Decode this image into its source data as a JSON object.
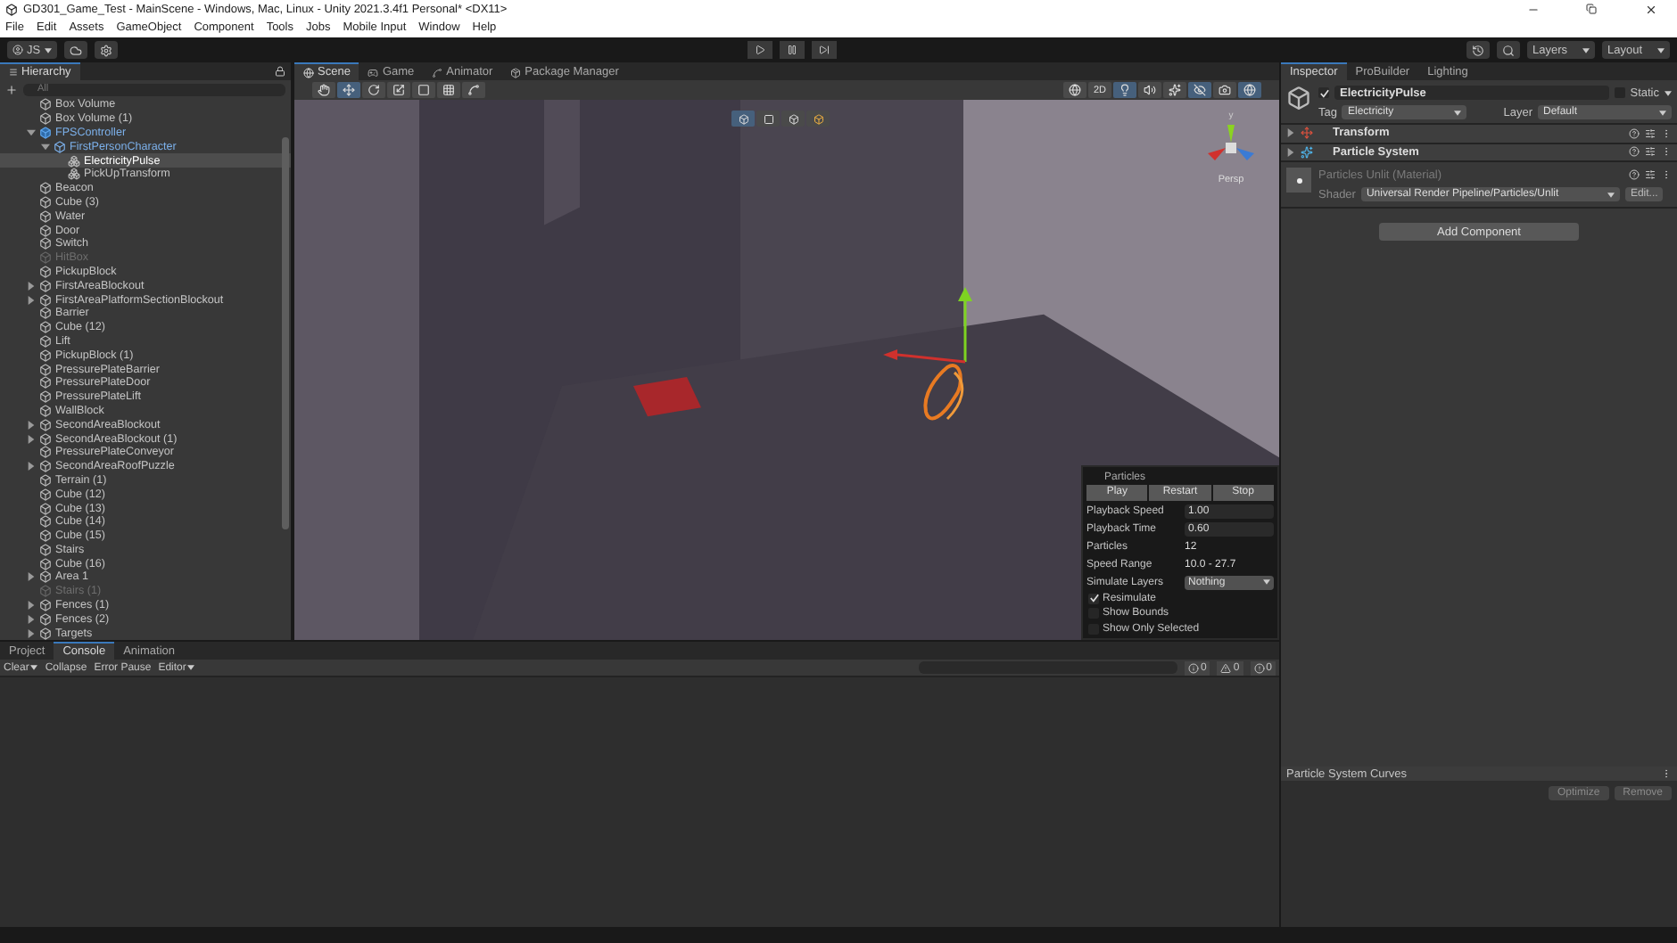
{
  "window": {
    "title": "GD301_Game_Test - MainScene - Windows, Mac, Linux - Unity 2021.3.4f1 Personal* <DX11>"
  },
  "menu": [
    "File",
    "Edit",
    "Assets",
    "GameObject",
    "Component",
    "Tools",
    "Jobs",
    "Mobile Input",
    "Window",
    "Help"
  ],
  "toolbar": {
    "account": "JS",
    "layers": "Layers",
    "layout": "Layout"
  },
  "hierarchy": {
    "title": "Hierarchy",
    "search_placeholder": "All",
    "items": [
      {
        "name": "Box Volume",
        "kind": "object",
        "selected": false,
        "disabled": false
      },
      {
        "name": "Box Volume (1)",
        "kind": "object",
        "selected": false,
        "disabled": false
      },
      {
        "name": "FPSController",
        "kind": "prefab",
        "selected": false,
        "disabled": false,
        "expanded": true,
        "children": [
          {
            "name": "FirstPersonCharacter",
            "kind": "prefab-child",
            "selected": false,
            "disabled": false,
            "expanded": true,
            "children": [
              {
                "name": "ElectricityPulse",
                "kind": "child",
                "selected": true,
                "disabled": false
              },
              {
                "name": "PickUpTransform",
                "kind": "child",
                "selected": false,
                "disabled": false
              }
            ]
          }
        ]
      },
      {
        "name": "Beacon",
        "kind": "object",
        "selected": false,
        "disabled": false
      },
      {
        "name": "Cube (3)",
        "kind": "object",
        "selected": false,
        "disabled": false
      },
      {
        "name": "Water",
        "kind": "object",
        "selected": false,
        "disabled": false
      },
      {
        "name": "Door",
        "kind": "object",
        "selected": false,
        "disabled": false
      },
      {
        "name": "Switch",
        "kind": "object",
        "selected": false,
        "disabled": false
      },
      {
        "name": "HitBox",
        "kind": "object",
        "selected": false,
        "disabled": true
      },
      {
        "name": "PickupBlock",
        "kind": "object",
        "selected": false,
        "disabled": false
      },
      {
        "name": "FirstAreaBlockout",
        "kind": "object",
        "selected": false,
        "disabled": false,
        "expanded": false
      },
      {
        "name": "FirstAreaPlatformSectionBlockout",
        "kind": "object",
        "selected": false,
        "disabled": false,
        "expanded": false
      },
      {
        "name": "Barrier",
        "kind": "object",
        "selected": false,
        "disabled": false
      },
      {
        "name": "Cube (12)",
        "kind": "object",
        "selected": false,
        "disabled": false
      },
      {
        "name": "Lift",
        "kind": "object",
        "selected": false,
        "disabled": false
      },
      {
        "name": "PickupBlock (1)",
        "kind": "object",
        "selected": false,
        "disabled": false
      },
      {
        "name": "PressurePlateBarrier",
        "kind": "object",
        "selected": false,
        "disabled": false
      },
      {
        "name": "PressurePlateDoor",
        "kind": "object",
        "selected": false,
        "disabled": false
      },
      {
        "name": "PressurePlateLift",
        "kind": "object",
        "selected": false,
        "disabled": false
      },
      {
        "name": "WallBlock",
        "kind": "object",
        "selected": false,
        "disabled": false
      },
      {
        "name": "SecondAreaBlockout",
        "kind": "object",
        "selected": false,
        "disabled": false,
        "expanded": false
      },
      {
        "name": "SecondAreaBlockout (1)",
        "kind": "object",
        "selected": false,
        "disabled": false,
        "expanded": false
      },
      {
        "name": "PressurePlateConveyor",
        "kind": "object",
        "selected": false,
        "disabled": false
      },
      {
        "name": "SecondAreaRoofPuzzle",
        "kind": "object",
        "selected": false,
        "disabled": false,
        "expanded": false
      },
      {
        "name": "Terrain (1)",
        "kind": "object",
        "selected": false,
        "disabled": false
      },
      {
        "name": "Cube (12)",
        "kind": "object",
        "selected": false,
        "disabled": false
      },
      {
        "name": "Cube (13)",
        "kind": "object",
        "selected": false,
        "disabled": false
      },
      {
        "name": "Cube (14)",
        "kind": "object",
        "selected": false,
        "disabled": false
      },
      {
        "name": "Cube (15)",
        "kind": "object",
        "selected": false,
        "disabled": false
      },
      {
        "name": "Stairs",
        "kind": "object",
        "selected": false,
        "disabled": false
      },
      {
        "name": "Cube (16)",
        "kind": "object",
        "selected": false,
        "disabled": false
      },
      {
        "name": "Area 1",
        "kind": "object",
        "selected": false,
        "disabled": false,
        "expanded": false
      },
      {
        "name": "Stairs (1)",
        "kind": "object",
        "selected": false,
        "disabled": true
      },
      {
        "name": "Fences (1)",
        "kind": "object",
        "selected": false,
        "disabled": false,
        "expanded": false
      },
      {
        "name": "Fences (2)",
        "kind": "object",
        "selected": false,
        "disabled": false,
        "expanded": false
      },
      {
        "name": "Targets",
        "kind": "object",
        "selected": false,
        "disabled": false,
        "expanded": false
      }
    ]
  },
  "scene_tabs": [
    {
      "label": "Scene",
      "selected": true
    },
    {
      "label": "Game",
      "selected": false
    },
    {
      "label": "Animator",
      "selected": false
    },
    {
      "label": "Package Manager",
      "selected": false
    }
  ],
  "scene": {
    "toggle_2d": "2D",
    "gizmo_label": "y",
    "projection": "Persp"
  },
  "particles": {
    "title": "Particles",
    "buttons": [
      "Play",
      "Restart",
      "Stop"
    ],
    "fields": [
      {
        "kind": "input",
        "label": "Playback Speed",
        "value": "1.00"
      },
      {
        "kind": "input",
        "label": "Playback Time",
        "value": "0.60"
      },
      {
        "kind": "text",
        "label": "Particles",
        "value": "12"
      },
      {
        "kind": "text",
        "label": "Speed Range",
        "value": "10.0 - 27.7"
      },
      {
        "kind": "dropdown",
        "label": "Simulate Layers",
        "value": "Nothing"
      }
    ],
    "options": [
      {
        "label": "Resimulate",
        "checked": true
      },
      {
        "label": "Show Bounds",
        "checked": false
      },
      {
        "label": "Show Only Selected",
        "checked": false
      }
    ]
  },
  "bottom_tabs": [
    {
      "label": "Project",
      "selected": false
    },
    {
      "label": "Console",
      "selected": true
    },
    {
      "label": "Animation",
      "selected": false
    }
  ],
  "console": {
    "buttons": [
      {
        "label": "Clear",
        "dropdown": true
      },
      {
        "label": "Collapse",
        "dropdown": false
      },
      {
        "label": "Error Pause",
        "dropdown": false
      },
      {
        "label": "Editor",
        "dropdown": true
      }
    ],
    "counts": [
      {
        "kind": "info",
        "value": "0"
      },
      {
        "kind": "warning",
        "value": "0"
      },
      {
        "kind": "error",
        "value": "0"
      }
    ]
  },
  "inspector": {
    "tabs": [
      {
        "label": "Inspector",
        "selected": true
      },
      {
        "label": "ProBuilder",
        "selected": false
      },
      {
        "label": "Lighting",
        "selected": false
      }
    ],
    "object": {
      "name": "ElectricityPulse",
      "active": true,
      "static_label": "Static",
      "static": false,
      "tag_label": "Tag",
      "tag": "Electricity",
      "layer_label": "Layer",
      "layer": "Default"
    },
    "components": [
      {
        "name": "Transform",
        "kind": "transform"
      },
      {
        "name": "Particle System",
        "kind": "particles"
      }
    ],
    "material": {
      "name": "Particles Unlit (Material)",
      "shader_label": "Shader",
      "shader": "Universal Render Pipeline/Particles/Unlit",
      "edit": "Edit..."
    },
    "add_component": "Add Component",
    "curves": {
      "title": "Particle System Curves",
      "buttons": [
        "Optimize",
        "Remove"
      ]
    }
  }
}
